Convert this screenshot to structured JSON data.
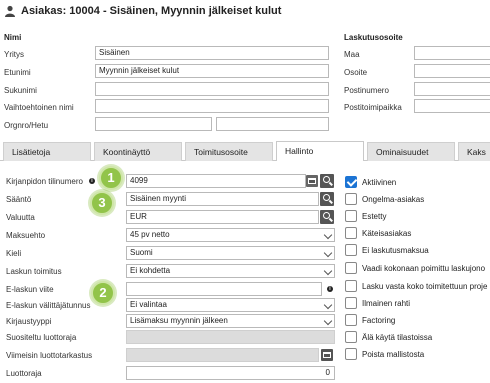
{
  "header": {
    "title": "Asiakas: 10004 - Sisäinen, Myynnin jälkeiset kulut"
  },
  "name_section": {
    "title": "Nimi",
    "fields": [
      {
        "label": "Yritys",
        "value": "Sisäinen"
      },
      {
        "label": "Etunimi",
        "value": "Myynnin jälkeiset kulut"
      },
      {
        "label": "Sukunimi",
        "value": ""
      },
      {
        "label": "Vaihtoehtoinen nimi",
        "value": ""
      },
      {
        "label": "Orgnro/Hetu",
        "value": "",
        "value2": ""
      }
    ]
  },
  "billing_section": {
    "title": "Laskutusosoite",
    "fields": [
      {
        "label": "Maa",
        "value": ""
      },
      {
        "label": "Osoite",
        "value": ""
      },
      {
        "label": "Postinumero",
        "value": ""
      },
      {
        "label": "Postitoimipaikka",
        "value": ""
      }
    ]
  },
  "tabs": [
    {
      "label": "Lisätietoja"
    },
    {
      "label": "Koontinäyttö"
    },
    {
      "label": "Toimitusosoite"
    },
    {
      "label": "Hallinto",
      "active": true
    },
    {
      "label": "Ominaisuudet"
    },
    {
      "label": "Kaks"
    }
  ],
  "admin_form": [
    {
      "label": "Kirjanpidon tilinumero",
      "value": "4099"
    },
    {
      "label": "Sääntö",
      "value": "Sisäinen myynti"
    },
    {
      "label": "Valuutta",
      "value": "EUR"
    },
    {
      "label": "Maksuehto",
      "value": "45 pv netto"
    },
    {
      "label": "Kieli",
      "value": "Suomi"
    },
    {
      "label": "Laskun toimitus",
      "value": "Ei kohdetta"
    },
    {
      "label": "E-laskun viite",
      "value": ""
    },
    {
      "label": "E-laskun välittäjätunnus",
      "value": "Ei valintaa"
    },
    {
      "label": "Kirjaustyyppi",
      "value": "Lisämaksu myynnin jälkeen"
    },
    {
      "label": "Suositeltu luottoraja",
      "value": ""
    },
    {
      "label": "Viimeisin luottotarkastus",
      "value": ""
    },
    {
      "label": "Luottoraja",
      "value": "0"
    }
  ],
  "badges": [
    "1",
    "3",
    "2"
  ],
  "checkboxes": [
    {
      "label": "Aktiivinen",
      "checked": true
    },
    {
      "label": "Ongelma-asiakas",
      "checked": false
    },
    {
      "label": "Estetty",
      "checked": false
    },
    {
      "label": "Käteisasiakas",
      "checked": false
    },
    {
      "label": "Ei laskutusmaksua",
      "checked": false
    },
    {
      "label": "Vaadi kokonaan poimittu laskujono",
      "checked": false
    },
    {
      "label": "Lasku vasta koko toimitettuun proje",
      "checked": false
    },
    {
      "label": "Ilmainen rahti",
      "checked": false
    },
    {
      "label": "Factoring",
      "checked": false
    },
    {
      "label": "Älä käytä tilastoissa",
      "checked": false
    },
    {
      "label": "Poista mallistosta",
      "checked": false
    }
  ],
  "colors": {
    "badge": "#92c44a",
    "checkbox_checked": "#1c74d4",
    "tab_inactive": "#e4e4e4"
  },
  "icons": [
    "user-icon",
    "info-icon",
    "search-icon",
    "calendar-icon",
    "chevron-down-icon",
    "checkmark-icon"
  ]
}
